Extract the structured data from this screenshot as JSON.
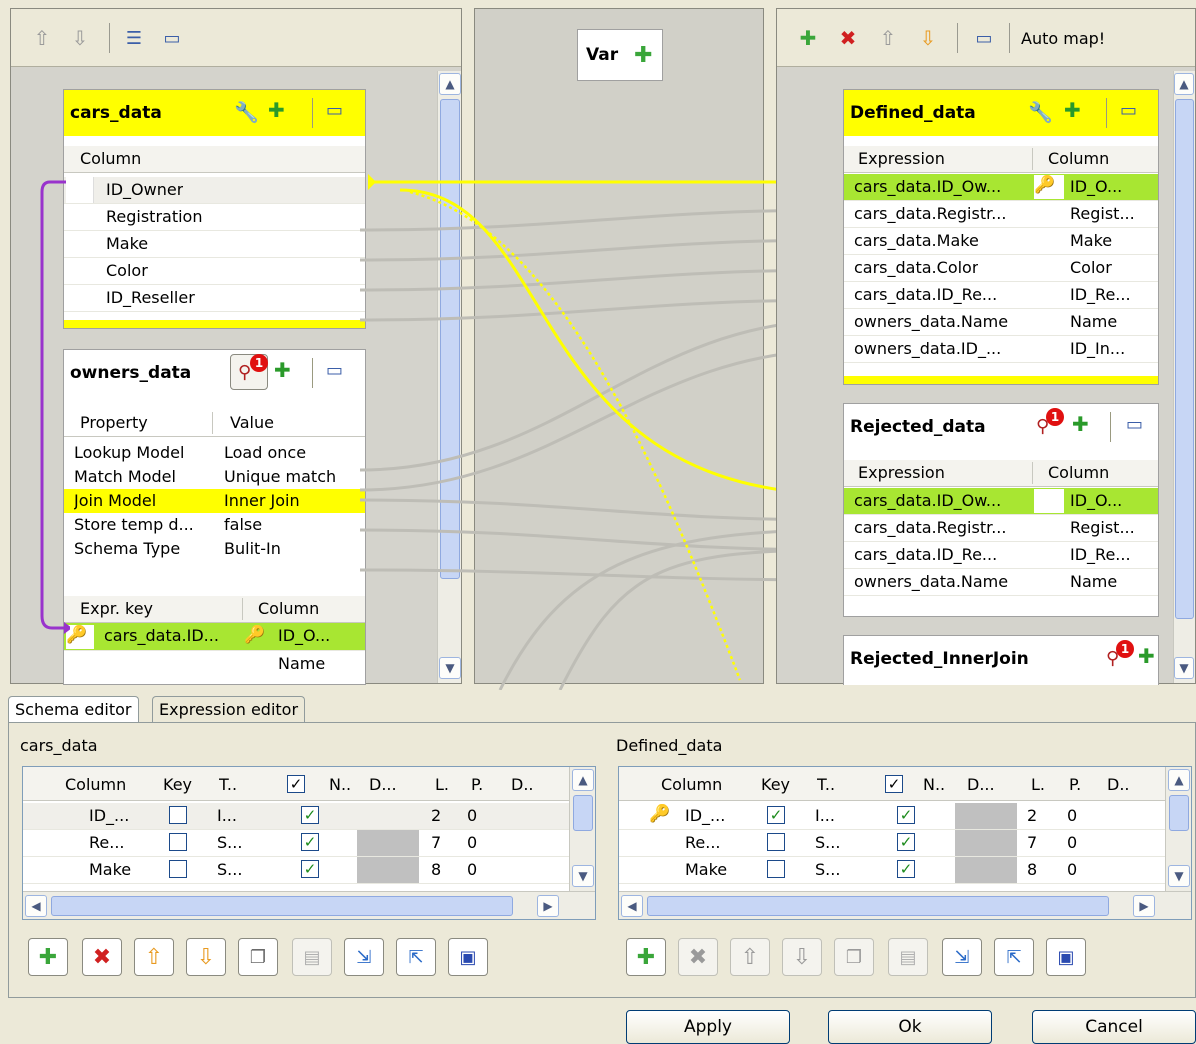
{
  "left_toolbar": {
    "icons": [
      "up-arrow-icon",
      "down-arrow-icon",
      "table-icon",
      "window-icon"
    ]
  },
  "var_panel": {
    "label": "Var"
  },
  "right_toolbar": {
    "auto_map": "Auto map!"
  },
  "cars_data": {
    "title": "cars_data",
    "column_header": "Column",
    "rows": [
      "ID_Owner",
      "Registration",
      "Make",
      "Color",
      "ID_Reseller"
    ]
  },
  "owners_data": {
    "title": "owners_data",
    "prop_header": "Property",
    "value_header": "Value",
    "props": [
      {
        "p": "Lookup Model",
        "v": "Load once"
      },
      {
        "p": "Match Model",
        "v": "Unique match"
      },
      {
        "p": "Join Model",
        "v": "Inner Join"
      },
      {
        "p": "Store temp d...",
        "v": "false"
      },
      {
        "p": "Schema Type",
        "v": "Bulit-In"
      }
    ],
    "expr_header": "Expr. key",
    "col_header": "Column",
    "expr_rows": [
      {
        "e": "cars_data.ID...",
        "c": "ID_O..."
      },
      {
        "e": "",
        "c": "Name"
      }
    ],
    "badge": "1"
  },
  "defined_data": {
    "title": "Defined_data",
    "expr_header": "Expression",
    "col_header": "Column",
    "rows": [
      {
        "e": "cars_data.ID_Ow...",
        "c": "ID_O..."
      },
      {
        "e": "cars_data.Registr...",
        "c": "Regist..."
      },
      {
        "e": "cars_data.Make",
        "c": "Make"
      },
      {
        "e": "cars_data.Color",
        "c": "Color"
      },
      {
        "e": "cars_data.ID_Re...",
        "c": "ID_Re..."
      },
      {
        "e": "owners_data.Name",
        "c": "Name"
      },
      {
        "e": "owners_data.ID_...",
        "c": "ID_In..."
      }
    ]
  },
  "rejected_data": {
    "title": "Rejected_data",
    "expr_header": "Expression",
    "col_header": "Column",
    "badge": "1",
    "rows": [
      {
        "e": "cars_data.ID_Ow...",
        "c": "ID_O..."
      },
      {
        "e": "cars_data.Registr...",
        "c": "Regist..."
      },
      {
        "e": "cars_data.ID_Re...",
        "c": "ID_Re..."
      },
      {
        "e": "owners_data.Name",
        "c": "Name"
      }
    ]
  },
  "rejected_inner": {
    "title": "Rejected_InnerJoin",
    "badge": "1"
  },
  "tabs": {
    "schema": "Schema editor",
    "expression": "Expression editor"
  },
  "schema_left": {
    "title": "cars_data",
    "headers": [
      "Column",
      "Key",
      "T..",
      "",
      "N..",
      "D...",
      "L.",
      "P.",
      "D.."
    ],
    "rows": [
      {
        "col": "ID_...",
        "type": "I...",
        "len": "2",
        "prec": "0"
      },
      {
        "col": "Re...",
        "type": "S...",
        "len": "7",
        "prec": "0"
      },
      {
        "col": "Make",
        "type": "S...",
        "len": "8",
        "prec": "0"
      }
    ]
  },
  "schema_right": {
    "title": "Defined_data",
    "headers": [
      "Column",
      "Key",
      "T..",
      "",
      "N..",
      "D...",
      "L.",
      "P.",
      "D.."
    ],
    "rows": [
      {
        "col": "ID_...",
        "type": "I...",
        "len": "2",
        "prec": "0"
      },
      {
        "col": "Re...",
        "type": "S...",
        "len": "7",
        "prec": "0"
      },
      {
        "col": "Make",
        "type": "S...",
        "len": "8",
        "prec": "0"
      }
    ]
  },
  "dialog": {
    "apply": "Apply",
    "ok": "Ok",
    "cancel": "Cancel"
  },
  "colors": {
    "highlight_yellow": "#ffff00",
    "highlight_green": "#a8e632",
    "link_purple": "#9933cc"
  }
}
